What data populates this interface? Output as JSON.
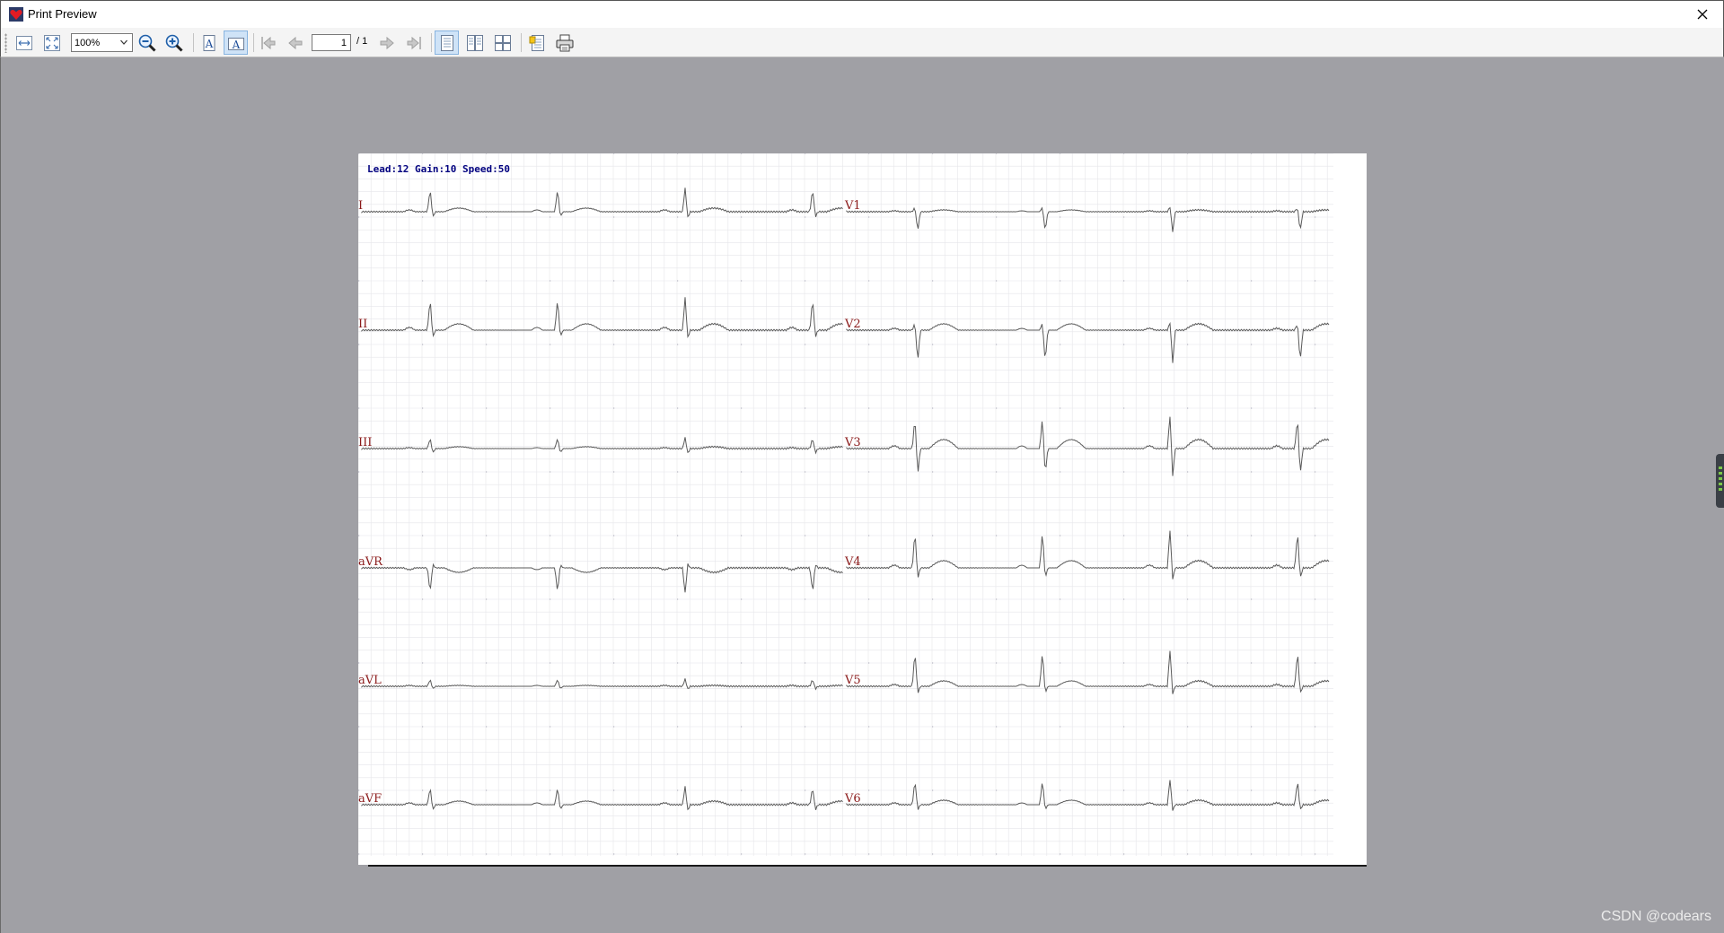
{
  "window": {
    "title": "Print Preview",
    "close_icon": "close-icon",
    "app_icon": "heart-app-icon"
  },
  "toolbar": {
    "zoom_value": "100%",
    "page_current": "1",
    "page_total": "/ 1",
    "buttons": [
      {
        "name": "fit-width-button",
        "icon": "fit-width-icon"
      },
      {
        "name": "fit-page-button",
        "icon": "fit-page-icon"
      },
      {
        "name": "zoom-out-button",
        "icon": "zoom-out-icon"
      },
      {
        "name": "zoom-in-button",
        "icon": "zoom-in-icon"
      },
      {
        "name": "portrait-button",
        "icon": "portrait-icon"
      },
      {
        "name": "landscape-button",
        "icon": "landscape-icon",
        "checked": true
      },
      {
        "name": "first-page-button",
        "icon": "first-page-icon"
      },
      {
        "name": "previous-page-button",
        "icon": "previous-page-icon"
      },
      {
        "name": "next-page-button",
        "icon": "next-page-icon"
      },
      {
        "name": "last-page-button",
        "icon": "last-page-icon"
      },
      {
        "name": "single-page-button",
        "icon": "single-page-icon",
        "checked": true
      },
      {
        "name": "facing-pages-button",
        "icon": "facing-pages-icon"
      },
      {
        "name": "all-pages-button",
        "icon": "all-pages-icon"
      },
      {
        "name": "page-setup-button",
        "icon": "page-setup-icon"
      },
      {
        "name": "print-button",
        "icon": "printer-icon"
      }
    ]
  },
  "document": {
    "header": "Lead:12 Gain:10 Speed:50",
    "leads_left": [
      "I",
      "II",
      "III",
      "aVR",
      "aVL",
      "aVF"
    ],
    "leads_right": [
      "V1",
      "V2",
      "V3",
      "V4",
      "V5",
      "V6"
    ],
    "colors": {
      "header": "#00007f",
      "lead_label": "#8b1a1a",
      "trace": "#5a5a5a",
      "grid": "#e6e6ea",
      "dots": "#b8b8c4"
    }
  },
  "watermark": "CSDN @codears"
}
